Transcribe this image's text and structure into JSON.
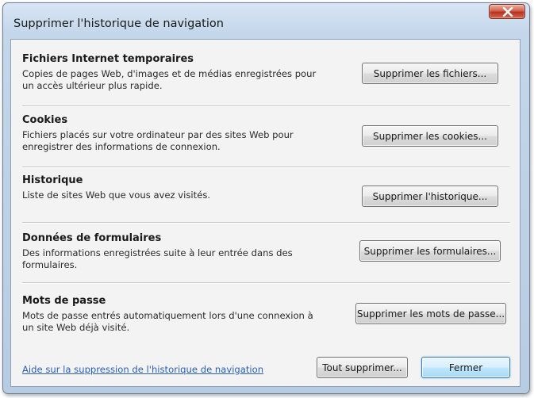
{
  "window": {
    "title": "Supprimer l'historique de navigation",
    "close_icon": "close-icon"
  },
  "sections": [
    {
      "title": "Fichiers Internet temporaires",
      "description": "Copies de pages Web, d'images et de médias enregistrées pour un accès ultérieur plus rapide.",
      "button_label": "Supprimer les fichiers..."
    },
    {
      "title": "Cookies",
      "description": "Fichiers placés sur votre ordinateur par des sites Web pour enregistrer des informations de connexion.",
      "button_label": "Supprimer les cookies..."
    },
    {
      "title": "Historique",
      "description": "Liste de sites Web que vous avez visités.",
      "button_label": "Supprimer l'historique..."
    },
    {
      "title": "Données de formulaires",
      "description": "Des informations enregistrées suite à leur entrée dans des formulaires.",
      "button_label": "Supprimer les formulaires..."
    },
    {
      "title": "Mots de passe",
      "description": "Mots de passe entrés automatiquement lors d'une connexion à un site Web déjà visité.",
      "button_label": "Supprimer les mots de passe..."
    }
  ],
  "footer": {
    "help_link": "Aide sur la suppression de l'historique de navigation",
    "delete_all_label": "Tout supprimer...",
    "close_label": "Fermer"
  },
  "colors": {
    "link": "#2b5fb4",
    "close_button": "#c8432c",
    "title_bar": "#c3d6ea"
  }
}
